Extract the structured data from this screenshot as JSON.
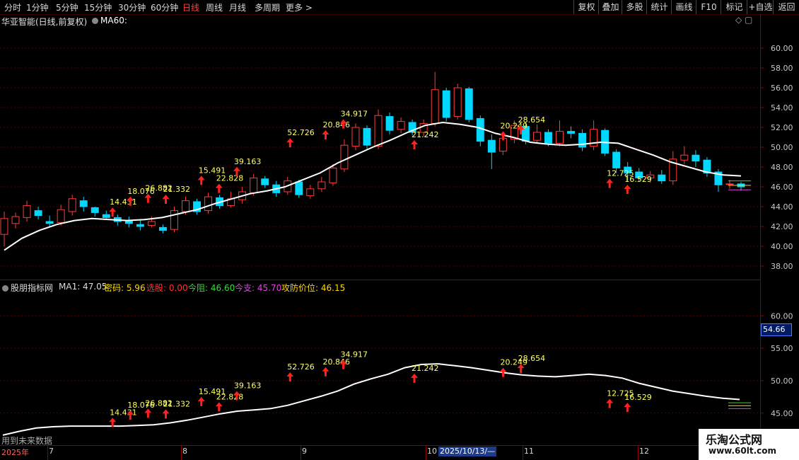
{
  "toolbar": {
    "periods": [
      "分时",
      "1分钟",
      "5分钟",
      "15分钟",
      "30分钟",
      "60分钟",
      "日线",
      "周线",
      "月线",
      "多周期",
      "更多 >"
    ],
    "active": "日线",
    "right_buttons": [
      "复权",
      "叠加",
      "多股",
      "统计",
      "画线",
      "F10",
      "标记",
      "+自选",
      "返回"
    ]
  },
  "main_title": "华亚智能(日线,前复权)",
  "ma_label": "MA60:",
  "indicator": {
    "name": "股朋指标网",
    "items": [
      {
        "label": "MA1: 47.05",
        "color": "#dddddd"
      },
      {
        "label": "密码: 5.96",
        "color": "#ffd700"
      },
      {
        "label": "选股: 0.00",
        "color": "#ff3030"
      },
      {
        "label": "今阻: 46.60",
        "color": "#33dd33"
      },
      {
        "label": "今支: 45.70",
        "color": "#dd44dd"
      },
      {
        "label": "攻防价位: 46.15",
        "color": "#ffd700"
      }
    ],
    "current_value": "54.66",
    "no_future_text": "用到未来数据"
  },
  "date_axis": {
    "year": "2025年",
    "months": [
      "7",
      "8",
      "9",
      "10",
      "11",
      "12"
    ],
    "current_date": "2025/10/13/—"
  },
  "watermark": {
    "line1": "乐淘公式网",
    "line2": "www.60lt.com"
  },
  "colors": {
    "up": "#ff3b3b",
    "down": "#00d8ff",
    "ma": "#ffffff",
    "label": "#ffff66",
    "arrow": "#ff2020"
  },
  "chart_data": [
    {
      "type": "candlestick",
      "title": "华亚智能(日线,前复权)",
      "ylim": [
        37,
        62
      ],
      "y_ticks": [
        "38.00",
        "40.00",
        "42.00",
        "44.00",
        "46.00",
        "48.00",
        "50.00",
        "52.00",
        "54.00",
        "56.00",
        "58.00",
        "60.00"
      ],
      "ma60": [
        39.6,
        40.8,
        41.6,
        42.2,
        42.6,
        42.8,
        42.7,
        42.6,
        42.7,
        42.9,
        43.3,
        43.7,
        44.3,
        44.8,
        45.3,
        45.6,
        46.0,
        46.7,
        47.4,
        48.4,
        49.2,
        50.0,
        50.7,
        51.5,
        52.2,
        52.5,
        52.3,
        52.0,
        51.4,
        51.0,
        50.5,
        50.3,
        50.2,
        50.3,
        50.5,
        50.4,
        49.8,
        49.2,
        48.5,
        48.0,
        47.5,
        47.2,
        47.1
      ],
      "candles": [
        [
          41.2,
          42.8,
          40.0,
          43.5
        ],
        [
          42.3,
          43.0,
          41.8,
          43.4
        ],
        [
          42.9,
          44.1,
          42.5,
          44.6
        ],
        [
          43.6,
          43.1,
          42.7,
          44.0
        ],
        [
          42.5,
          42.3,
          42.0,
          43.1
        ],
        [
          42.4,
          43.7,
          42.1,
          44.2
        ],
        [
          43.5,
          44.8,
          43.1,
          45.2
        ],
        [
          44.6,
          44.0,
          43.5,
          45.0
        ],
        [
          43.9,
          43.4,
          43.0,
          44.0
        ],
        [
          43.2,
          42.9,
          42.7,
          43.6
        ],
        [
          42.9,
          42.5,
          42.1,
          43.2
        ],
        [
          42.6,
          42.3,
          41.9,
          43.0
        ],
        [
          42.2,
          42.0,
          41.6,
          42.7
        ],
        [
          42.1,
          42.5,
          41.9,
          43.0
        ],
        [
          41.9,
          41.6,
          41.3,
          42.2
        ],
        [
          41.7,
          43.6,
          41.4,
          44.0
        ],
        [
          43.5,
          44.6,
          43.2,
          45.0
        ],
        [
          44.5,
          43.5,
          43.2,
          44.8
        ],
        [
          43.6,
          45.0,
          43.3,
          45.4
        ],
        [
          44.9,
          44.1,
          43.8,
          45.2
        ],
        [
          44.1,
          44.8,
          43.9,
          45.5
        ],
        [
          44.7,
          45.5,
          44.3,
          46.0
        ],
        [
          45.4,
          46.9,
          45.1,
          47.3
        ],
        [
          46.8,
          46.2,
          45.9,
          47.1
        ],
        [
          46.2,
          45.4,
          45.0,
          46.6
        ],
        [
          45.5,
          46.6,
          45.2,
          47.0
        ],
        [
          46.5,
          45.2,
          44.9,
          46.7
        ],
        [
          45.1,
          45.8,
          44.8,
          46.2
        ],
        [
          45.8,
          46.5,
          45.5,
          47.0
        ],
        [
          46.4,
          47.9,
          46.1,
          48.3
        ],
        [
          47.8,
          50.2,
          47.5,
          50.8
        ],
        [
          50.1,
          52.0,
          49.7,
          52.4
        ],
        [
          51.9,
          50.2,
          49.8,
          52.2
        ],
        [
          50.1,
          53.2,
          49.8,
          53.8
        ],
        [
          53.1,
          51.7,
          51.3,
          53.5
        ],
        [
          51.8,
          52.6,
          51.4,
          53.0
        ],
        [
          52.5,
          51.5,
          51.2,
          52.8
        ],
        [
          51.5,
          52.4,
          51.1,
          52.8
        ],
        [
          52.4,
          55.8,
          52.1,
          57.6
        ],
        [
          55.7,
          53.0,
          52.6,
          56.0
        ],
        [
          53.1,
          56.0,
          52.8,
          56.4
        ],
        [
          55.9,
          52.8,
          52.5,
          56.1
        ],
        [
          52.9,
          50.6,
          50.1,
          53.2
        ],
        [
          50.7,
          49.5,
          47.8,
          51.3
        ],
        [
          49.6,
          50.9,
          49.2,
          51.5
        ],
        [
          50.8,
          52.2,
          50.4,
          52.7
        ],
        [
          52.1,
          50.6,
          50.3,
          52.5
        ],
        [
          50.7,
          51.5,
          50.4,
          52.3
        ],
        [
          51.5,
          50.4,
          50.1,
          51.8
        ],
        [
          50.4,
          51.6,
          50.1,
          52.7
        ],
        [
          51.6,
          51.4,
          50.9,
          52.1
        ],
        [
          51.4,
          50.0,
          49.6,
          51.8
        ],
        [
          50.1,
          51.8,
          49.7,
          52.7
        ],
        [
          51.7,
          49.4,
          49.1,
          51.9
        ],
        [
          49.5,
          47.9,
          47.4,
          49.8
        ],
        [
          48.0,
          47.4,
          46.6,
          48.5
        ],
        [
          47.5,
          46.9,
          46.5,
          47.9
        ],
        [
          46.9,
          47.2,
          46.4,
          47.6
        ],
        [
          47.2,
          46.6,
          46.3,
          47.7
        ],
        [
          46.6,
          48.8,
          46.2,
          49.6
        ],
        [
          48.7,
          49.2,
          48.3,
          50.1
        ],
        [
          49.2,
          48.6,
          48.0,
          49.7
        ],
        [
          48.7,
          47.4,
          47.0,
          49.0
        ],
        [
          47.5,
          46.2,
          45.5,
          47.8
        ],
        [
          46.3,
          46.3,
          45.8,
          46.7
        ],
        [
          46.3,
          46.0,
          45.6,
          46.5
        ]
      ],
      "signals": [
        {
          "value": "14.431",
          "slot": 6,
          "y": 43.2
        },
        {
          "value": "18.076",
          "slot": 7,
          "y": 44.3
        },
        {
          "value": "26.882",
          "slot": 8,
          "y": 44.6
        },
        {
          "value": "21.332",
          "slot": 9,
          "y": 44.5
        },
        {
          "value": "15.491",
          "slot": 11,
          "y": 46.4
        },
        {
          "value": "22.828",
          "slot": 12,
          "y": 45.6
        },
        {
          "value": "39.163",
          "slot": 13,
          "y": 47.3
        },
        {
          "value": "52.726",
          "slot": 16,
          "y": 50.2
        },
        {
          "value": "20.846",
          "slot": 18,
          "y": 51.0
        },
        {
          "value": "34.917",
          "slot": 19,
          "y": 52.1
        },
        {
          "value": "21.242",
          "slot": 23,
          "y": 50.0
        },
        {
          "value": "20.249",
          "slot": 28,
          "y": 50.9
        },
        {
          "value": "28.654",
          "slot": 29,
          "y": 51.5
        },
        {
          "value": "12.725",
          "slot": 34,
          "y": 46.1
        },
        {
          "value": "16.529",
          "slot": 35,
          "y": 45.5
        }
      ]
    },
    {
      "type": "line",
      "title": "股朋指标网",
      "ylim": [
        40.5,
        64.5
      ],
      "y_ticks": [
        "45.00",
        "50.00",
        "55.00",
        "60.00"
      ],
      "values": [
        41.6,
        42.2,
        42.7,
        42.9,
        43.0,
        43.0,
        43.0,
        43.0,
        43.1,
        43.2,
        43.5,
        43.9,
        44.4,
        44.9,
        45.3,
        45.5,
        45.7,
        46.2,
        46.9,
        47.6,
        48.4,
        49.5,
        50.3,
        51.0,
        52.0,
        52.5,
        52.6,
        52.3,
        52.0,
        51.6,
        51.2,
        50.9,
        50.7,
        50.6,
        50.8,
        51.0,
        50.8,
        50.4,
        49.6,
        49.0,
        48.4,
        48.0,
        47.6,
        47.3,
        47.1
      ]
    }
  ]
}
